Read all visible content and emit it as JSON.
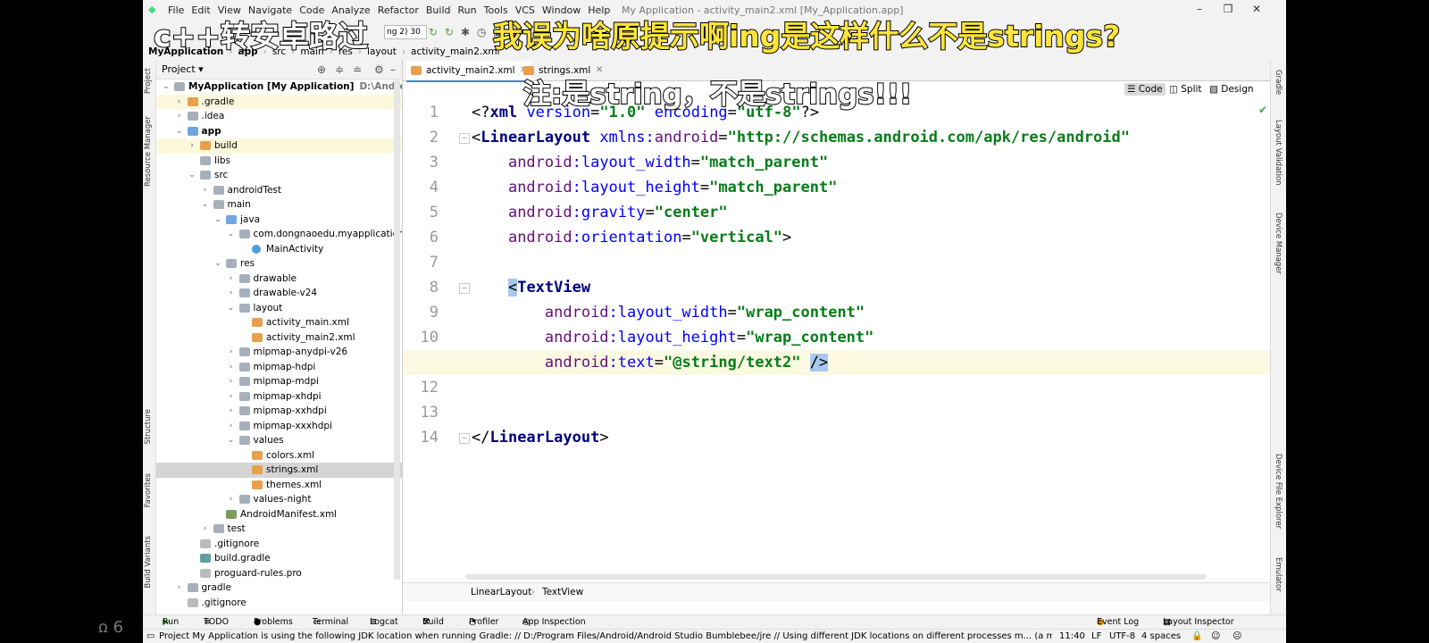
{
  "menubar": {
    "items": [
      "File",
      "Edit",
      "View",
      "Navigate",
      "Code",
      "Analyze",
      "Refactor",
      "Build",
      "Run",
      "Tools",
      "VCS",
      "Window",
      "Help"
    ],
    "window_title": "My Application - activity_main2.xml [My_Application.app]"
  },
  "toolbar": {
    "run_config": "ng 2) 30"
  },
  "breadcrumb": [
    "MyApplication",
    "app",
    "src",
    "main",
    "res",
    "layout",
    "activity_main2.xml"
  ],
  "left_tools": [
    "Project",
    "Resource Manager",
    "Structure",
    "Favorites",
    "Build Variants"
  ],
  "right_tools": [
    "Gradle",
    "Layout Validation",
    "Device Manager",
    "Device File Explorer",
    "Emulator"
  ],
  "project_panel": {
    "title": "Project",
    "tree": [
      {
        "label": "MyApplication [My Application]",
        "extra": "D:\\Android\\Andr",
        "depth": 0,
        "arrow": "v",
        "icon": "folder-gray",
        "bold": true
      },
      {
        "label": ".gradle",
        "depth": 1,
        "arrow": ">",
        "icon": "folder-orange",
        "highlight": true
      },
      {
        "label": ".idea",
        "depth": 1,
        "arrow": ">",
        "icon": "folder-gray"
      },
      {
        "label": "app",
        "depth": 1,
        "arrow": "v",
        "icon": "folder-module",
        "bold": true
      },
      {
        "label": "build",
        "depth": 2,
        "arrow": ">",
        "icon": "folder-orange",
        "highlight": true
      },
      {
        "label": "libs",
        "depth": 2,
        "arrow": "",
        "icon": "folder-gray"
      },
      {
        "label": "src",
        "depth": 2,
        "arrow": "v",
        "icon": "folder-gray"
      },
      {
        "label": "androidTest",
        "depth": 3,
        "arrow": ">",
        "icon": "folder-gray"
      },
      {
        "label": "main",
        "depth": 3,
        "arrow": "v",
        "icon": "folder-gray"
      },
      {
        "label": "java",
        "depth": 4,
        "arrow": "v",
        "icon": "folder-blue"
      },
      {
        "label": "com.dongnaoedu.myapplication",
        "depth": 5,
        "arrow": "v",
        "icon": "folder-gray"
      },
      {
        "label": "MainActivity",
        "depth": 6,
        "arrow": "",
        "icon": "class"
      },
      {
        "label": "res",
        "depth": 4,
        "arrow": "v",
        "icon": "folder-res"
      },
      {
        "label": "drawable",
        "depth": 5,
        "arrow": ">",
        "icon": "folder-gray"
      },
      {
        "label": "drawable-v24",
        "depth": 5,
        "arrow": ">",
        "icon": "folder-gray"
      },
      {
        "label": "layout",
        "depth": 5,
        "arrow": "v",
        "icon": "folder-gray"
      },
      {
        "label": "activity_main.xml",
        "depth": 6,
        "arrow": "",
        "icon": "xml"
      },
      {
        "label": "activity_main2.xml",
        "depth": 6,
        "arrow": "",
        "icon": "xml"
      },
      {
        "label": "mipmap-anydpi-v26",
        "depth": 5,
        "arrow": ">",
        "icon": "folder-gray"
      },
      {
        "label": "mipmap-hdpi",
        "depth": 5,
        "arrow": ">",
        "icon": "folder-gray"
      },
      {
        "label": "mipmap-mdpi",
        "depth": 5,
        "arrow": ">",
        "icon": "folder-gray"
      },
      {
        "label": "mipmap-xhdpi",
        "depth": 5,
        "arrow": ">",
        "icon": "folder-gray"
      },
      {
        "label": "mipmap-xxhdpi",
        "depth": 5,
        "arrow": ">",
        "icon": "folder-gray"
      },
      {
        "label": "mipmap-xxxhdpi",
        "depth": 5,
        "arrow": ">",
        "icon": "folder-gray"
      },
      {
        "label": "values",
        "depth": 5,
        "arrow": "v",
        "icon": "folder-gray"
      },
      {
        "label": "colors.xml",
        "depth": 6,
        "arrow": "",
        "icon": "xml"
      },
      {
        "label": "strings.xml",
        "depth": 6,
        "arrow": "",
        "icon": "xml",
        "selected": true
      },
      {
        "label": "themes.xml",
        "depth": 6,
        "arrow": "",
        "icon": "xml"
      },
      {
        "label": "values-night",
        "depth": 5,
        "arrow": ">",
        "icon": "folder-gray"
      },
      {
        "label": "AndroidManifest.xml",
        "depth": 4,
        "arrow": "",
        "icon": "manifest"
      },
      {
        "label": "test",
        "depth": 3,
        "arrow": ">",
        "icon": "folder-gray"
      },
      {
        "label": ".gitignore",
        "depth": 2,
        "arrow": "",
        "icon": "file"
      },
      {
        "label": "build.gradle",
        "depth": 2,
        "arrow": "",
        "icon": "gradle"
      },
      {
        "label": "proguard-rules.pro",
        "depth": 2,
        "arrow": "",
        "icon": "file"
      },
      {
        "label": "gradle",
        "depth": 1,
        "arrow": ">",
        "icon": "folder-gray"
      },
      {
        "label": ".gitignore",
        "depth": 1,
        "arrow": "",
        "icon": "file"
      }
    ]
  },
  "editor": {
    "tabs": [
      {
        "label": "activity_main2.xml",
        "active": true
      },
      {
        "label": "strings.xml",
        "active": false
      }
    ],
    "modes": [
      "Code",
      "Split",
      "Design"
    ],
    "active_mode": "Code",
    "lines": [
      {
        "num": "1",
        "tokens": [
          [
            "pn",
            "<?"
          ],
          [
            "tg",
            "xml "
          ],
          [
            "at",
            "version"
          ],
          [
            "pn",
            "="
          ],
          [
            "vl",
            "\"1.0\""
          ],
          [
            "pn",
            " "
          ],
          [
            "at",
            "encoding"
          ],
          [
            "pn",
            "="
          ],
          [
            "vl",
            "\"utf-8\""
          ],
          [
            "pn",
            "?>"
          ]
        ]
      },
      {
        "num": "2",
        "tokens": [
          [
            "pn",
            "<"
          ],
          [
            "tg",
            "LinearLayout "
          ],
          [
            "at",
            "xmlns:"
          ],
          [
            "ns",
            "android"
          ],
          [
            "pn",
            "="
          ],
          [
            "vl",
            "\"http://schemas.android.com/apk/res/android\""
          ]
        ]
      },
      {
        "num": "3",
        "tokens": [
          [
            "pn",
            "    "
          ],
          [
            "ns",
            "android"
          ],
          [
            "at",
            ":layout_width"
          ],
          [
            "pn",
            "="
          ],
          [
            "vl",
            "\"match_parent\""
          ]
        ]
      },
      {
        "num": "4",
        "tokens": [
          [
            "pn",
            "    "
          ],
          [
            "ns",
            "android"
          ],
          [
            "at",
            ":layout_height"
          ],
          [
            "pn",
            "="
          ],
          [
            "vl",
            "\"match_parent\""
          ]
        ]
      },
      {
        "num": "5",
        "tokens": [
          [
            "pn",
            "    "
          ],
          [
            "ns",
            "android"
          ],
          [
            "at",
            ":gravity"
          ],
          [
            "pn",
            "="
          ],
          [
            "vl",
            "\"center\""
          ]
        ]
      },
      {
        "num": "6",
        "tokens": [
          [
            "pn",
            "    "
          ],
          [
            "ns",
            "android"
          ],
          [
            "at",
            ":orientation"
          ],
          [
            "pn",
            "="
          ],
          [
            "vl",
            "\"vertical\""
          ],
          [
            "pn",
            ">"
          ]
        ]
      },
      {
        "num": "7",
        "tokens": []
      },
      {
        "num": "8",
        "tokens": [
          [
            "pn",
            "    "
          ],
          [
            "brace",
            "<"
          ],
          [
            "tg",
            "TextView"
          ]
        ]
      },
      {
        "num": "9",
        "tokens": [
          [
            "pn",
            "        "
          ],
          [
            "ns",
            "android"
          ],
          [
            "at",
            ":layout_width"
          ],
          [
            "pn",
            "="
          ],
          [
            "vl",
            "\"wrap_content\""
          ]
        ]
      },
      {
        "num": "10",
        "tokens": [
          [
            "pn",
            "        "
          ],
          [
            "ns",
            "android"
          ],
          [
            "at",
            ":layout_height"
          ],
          [
            "pn",
            "="
          ],
          [
            "vl",
            "\"wrap_content\""
          ]
        ]
      },
      {
        "num": "11",
        "tokens": [
          [
            "pn",
            "        "
          ],
          [
            "ns",
            "android"
          ],
          [
            "at",
            ":text"
          ],
          [
            "pn",
            "="
          ],
          [
            "vl",
            "\"@string/text2\""
          ],
          [
            "pn",
            " "
          ],
          [
            "brace",
            "/>"
          ]
        ],
        "current": true
      },
      {
        "num": "12",
        "tokens": []
      },
      {
        "num": "13",
        "tokens": []
      },
      {
        "num": "14",
        "tokens": [
          [
            "pn",
            "</"
          ],
          [
            "tg",
            "LinearLayout"
          ],
          [
            "pn",
            ">"
          ]
        ]
      }
    ],
    "breadcrumb": [
      "LinearLayout",
      "TextView"
    ]
  },
  "tool_windows": [
    "Run",
    "TODO",
    "Problems",
    "Terminal",
    "Logcat",
    "Build",
    "Profiler",
    "App Inspection",
    "Event Log",
    "Layout Inspector"
  ],
  "status": {
    "message": "Project My Application is using the following JDK location when running Gradle: // D:/Program Files/Android/Android Studio Bumblebee/jre // Using different JDK locations on different processes m... (a minute ago)",
    "position": "11:40",
    "line_sep": "LF",
    "encoding": "UTF-8",
    "indent": "4 spaces"
  },
  "overlays": {
    "caption1": "c++转安卓路过",
    "caption2": "我误为啥原提示啊ing是这样什么不是strings?",
    "caption3": "注:是string，不是strings!!!",
    "watermark": "6"
  },
  "colors": {
    "tag": "#000080",
    "attr": "#0000ff",
    "namespace": "#660e7a",
    "value": "#067d17",
    "caption_yellow": "#ffe53b"
  }
}
